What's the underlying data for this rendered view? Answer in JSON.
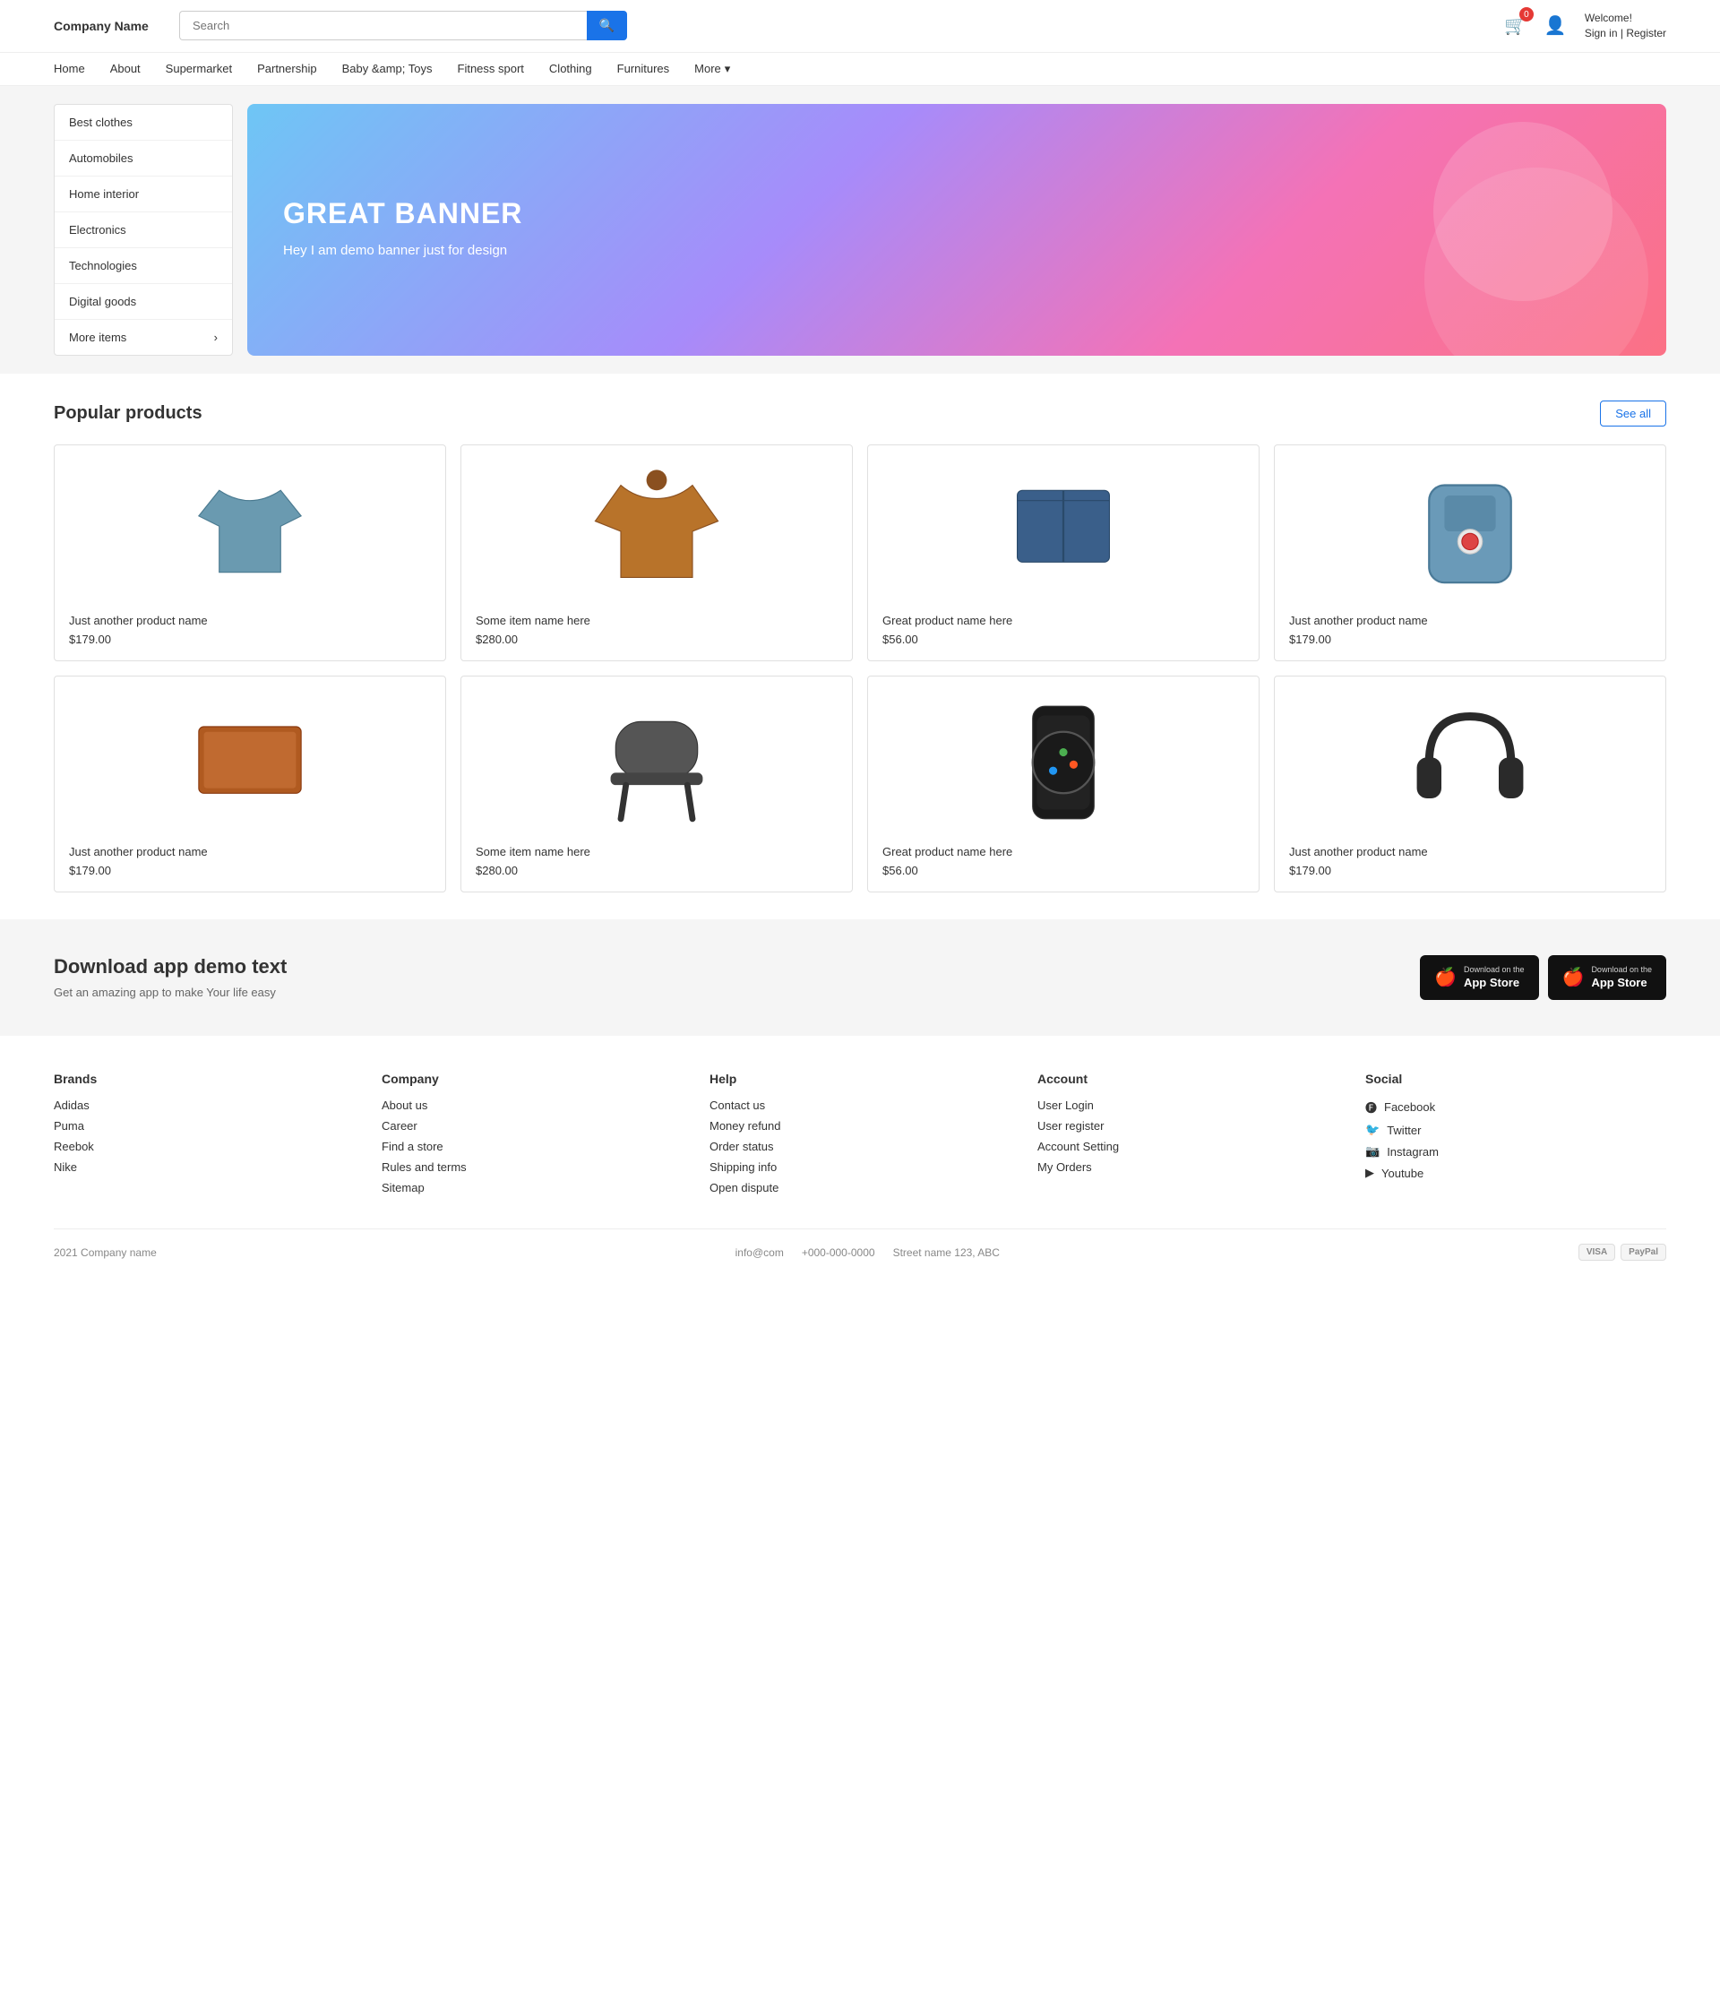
{
  "header": {
    "logo": "Company Name",
    "search_placeholder": "Search",
    "cart_count": "0",
    "welcome": "Welcome!",
    "sign_in": "Sign in",
    "register": "Register"
  },
  "nav": {
    "items": [
      {
        "label": "Home"
      },
      {
        "label": "About"
      },
      {
        "label": "Supermarket"
      },
      {
        "label": "Partnership"
      },
      {
        "label": "Baby &amp; Toys"
      },
      {
        "label": "Fitness sport"
      },
      {
        "label": "Clothing"
      },
      {
        "label": "Furnitures"
      },
      {
        "label": "More"
      }
    ]
  },
  "sidebar": {
    "items": [
      {
        "label": "Best clothes"
      },
      {
        "label": "Automobiles"
      },
      {
        "label": "Home interior"
      },
      {
        "label": "Electronics"
      },
      {
        "label": "Technologies"
      },
      {
        "label": "Digital goods"
      },
      {
        "label": "More items",
        "has_arrow": true
      }
    ]
  },
  "banner": {
    "title": "GREAT BANNER",
    "subtitle": "Hey I am demo banner just for design"
  },
  "products": {
    "section_title": "Popular products",
    "see_all": "See all",
    "items": [
      {
        "name": "Just another product name",
        "price": "$179.00",
        "type": "shirt"
      },
      {
        "name": "Some item name here",
        "price": "$280.00",
        "type": "jacket"
      },
      {
        "name": "Great product name here",
        "price": "$56.00",
        "type": "shorts"
      },
      {
        "name": "Just another product name",
        "price": "$179.00",
        "type": "backpack"
      },
      {
        "name": "Just another product name",
        "price": "$179.00",
        "type": "laptop"
      },
      {
        "name": "Some item name here",
        "price": "$280.00",
        "type": "chair"
      },
      {
        "name": "Great product name here",
        "price": "$56.00",
        "type": "watch"
      },
      {
        "name": "Just another product name",
        "price": "$179.00",
        "type": "headphones"
      }
    ]
  },
  "app": {
    "title": "Download app demo text",
    "subtitle": "Get an amazing app to make Your life easy",
    "btn1_small": "Download on the",
    "btn1_big": "App Store",
    "btn2_small": "Download on the",
    "btn2_big": "App Store"
  },
  "footer": {
    "brands": {
      "title": "Brands",
      "items": [
        "Adidas",
        "Puma",
        "Reebok",
        "Nike"
      ]
    },
    "company": {
      "title": "Company",
      "items": [
        "About us",
        "Career",
        "Find a store",
        "Rules and terms",
        "Sitemap"
      ]
    },
    "help": {
      "title": "Help",
      "items": [
        "Contact us",
        "Money refund",
        "Order status",
        "Shipping info",
        "Open dispute"
      ]
    },
    "account": {
      "title": "Account",
      "items": [
        "User Login",
        "User register",
        "Account Setting",
        "My Orders"
      ]
    },
    "social": {
      "title": "Social",
      "items": [
        {
          "label": "Facebook",
          "icon": "f"
        },
        {
          "label": "Twitter",
          "icon": "t"
        },
        {
          "label": "Instagram",
          "icon": "i"
        },
        {
          "label": "Youtube",
          "icon": "y"
        }
      ]
    },
    "bottom": {
      "copyright": "2021 Company name",
      "email": "info@com",
      "phone": "+000-000-0000",
      "address": "Street name 123, ABC"
    }
  }
}
